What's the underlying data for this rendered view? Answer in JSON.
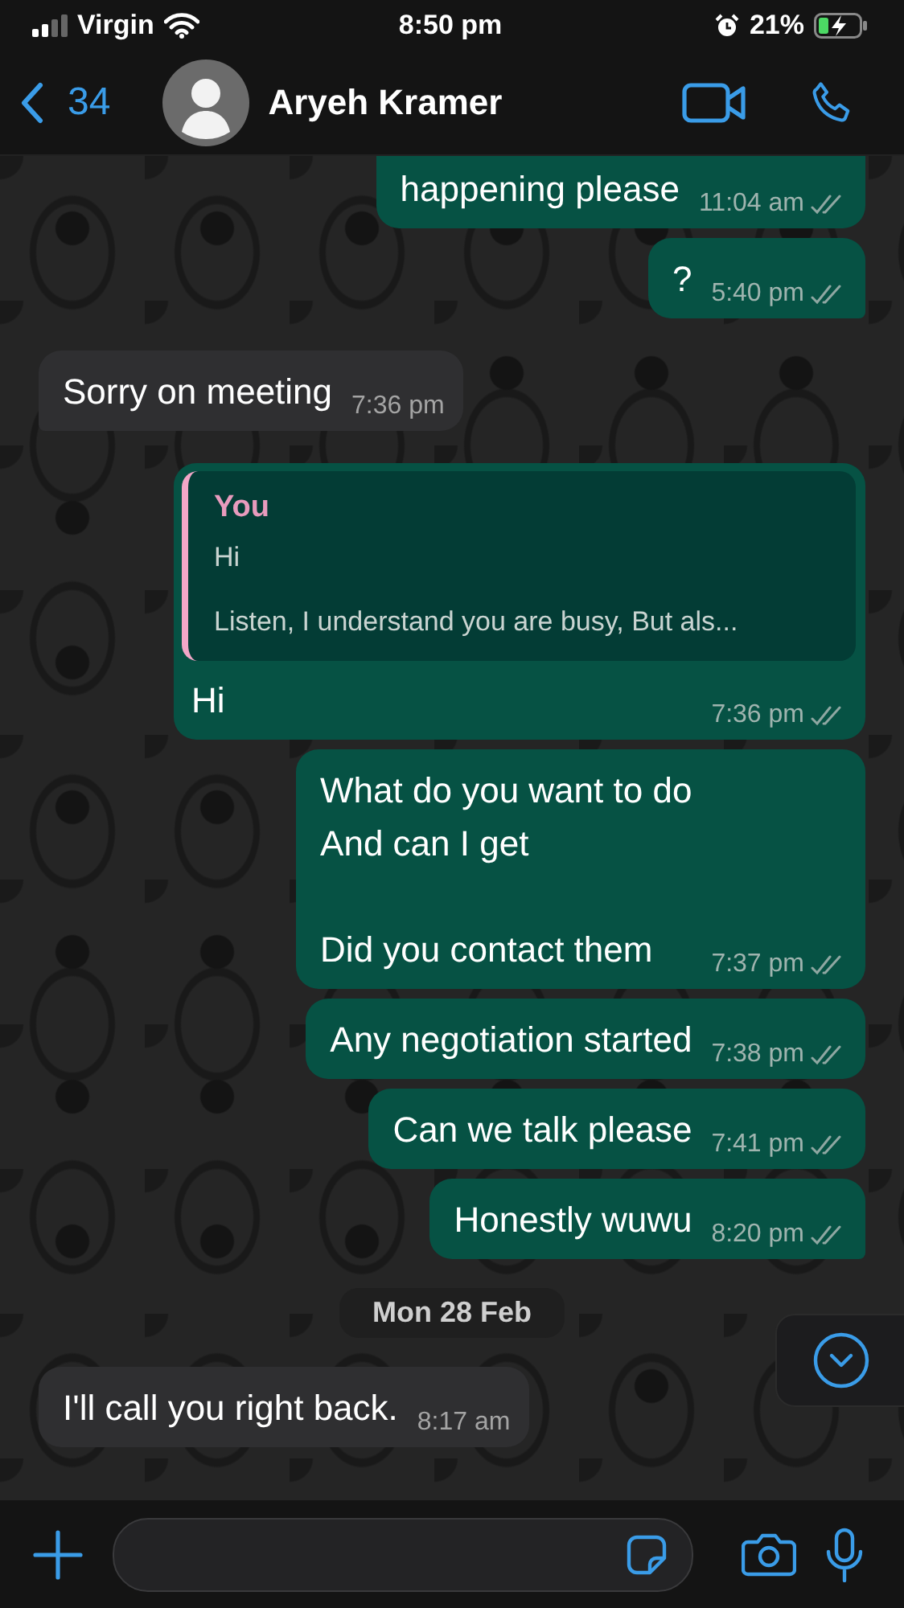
{
  "status_bar": {
    "carrier": "Virgin",
    "time": "8:50 pm",
    "battery": "21%",
    "charging": true
  },
  "header": {
    "back_count": "34",
    "contact_name": "Aryeh Kramer"
  },
  "messages": [
    {
      "kind": "out",
      "text": "happening please",
      "time": "11:04 am",
      "read": false,
      "cut_top": true,
      "tail": false
    },
    {
      "kind": "out",
      "text": "?",
      "time": "5:40 pm",
      "read": false,
      "tail": true
    },
    {
      "kind": "in",
      "text": "Sorry on meeting",
      "time": "7:36 pm",
      "tail": true
    },
    {
      "kind": "out",
      "text": "Hi",
      "time": "7:36 pm",
      "read": false,
      "tail": false,
      "quote": {
        "author": "You",
        "text": "Hi\n\nListen, I understand you are busy, But als..."
      }
    },
    {
      "kind": "out",
      "text": "What do you want to do\nAnd can I get\n\nDid you contact them",
      "time": "7:37 pm",
      "read": false,
      "tail": false
    },
    {
      "kind": "out",
      "text": "Any negotiation started",
      "time": "7:38 pm",
      "read": false,
      "tail": false
    },
    {
      "kind": "out",
      "text": "Can we talk please",
      "time": "7:41 pm",
      "read": false,
      "tail": false
    },
    {
      "kind": "out",
      "text": "Honestly wuwu",
      "time": "8:20 pm",
      "read": false,
      "tail": true
    },
    {
      "kind": "date",
      "text": "Mon 28 Feb"
    },
    {
      "kind": "in",
      "text": "I'll call you right back.",
      "time": "8:17 am",
      "tail": false
    }
  ]
}
